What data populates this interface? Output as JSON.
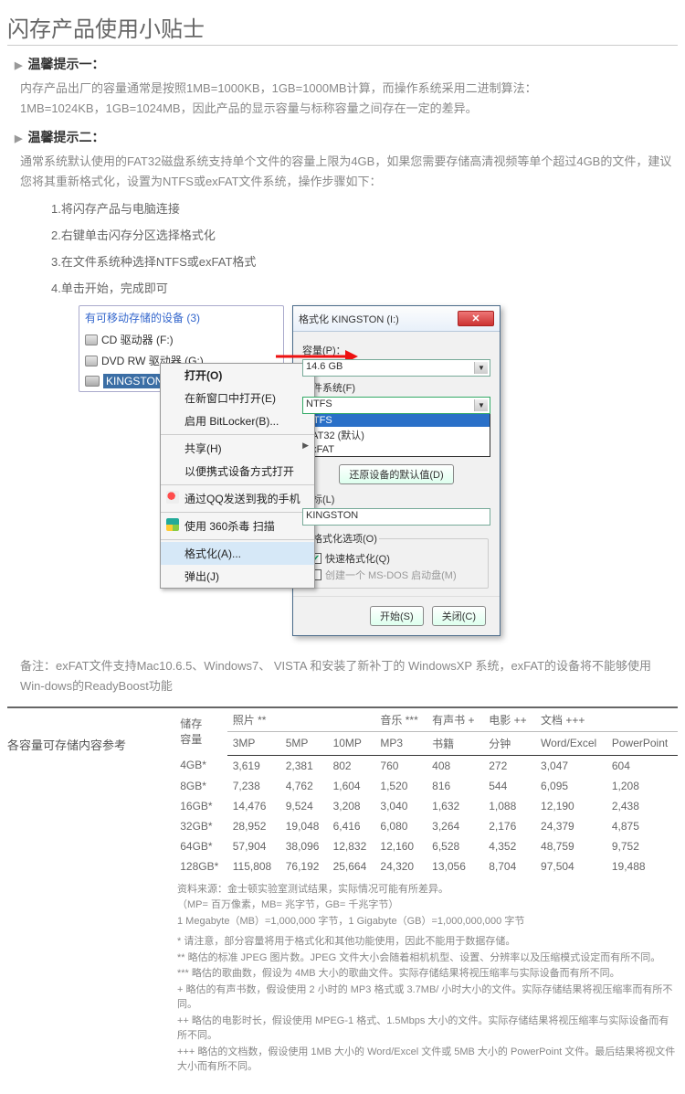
{
  "page": {
    "title": "闪存产品使用小贴士"
  },
  "tips": {
    "title1": "温馨提示一：",
    "text1a": "内存产品出厂的容量通常是按照1MB=1000KB，1GB=1000MB计算，而操作系统采用二进制算法：",
    "text1b": "1MB=1024KB，1GB=1024MB，因此产品的显示容量与标称容量之间存在一定的差异。",
    "title2": "温馨提示二：",
    "text2": "通常系统默认使用的FAT32磁盘系统支持单个文件的容量上限为4GB，如果您需要存储高清视频等单个超过4GB的文件，建议您将其重新格式化，设置为NTFS或exFAT文件系统，操作步骤如下：",
    "steps": [
      "1.将闪存产品与电脑连接",
      "2.右键单击闪存分区选择格式化",
      "3.在文件系统种选择NTFS或exFAT格式",
      "4.单击开始，完成即可"
    ]
  },
  "explorer": {
    "header": "有可移动存储的设备 (3)",
    "drives": [
      "CD 驱动器 (F:)",
      "DVD RW 驱动器 (G:)",
      "KINGSTON (I:)"
    ]
  },
  "context_menu": {
    "open": "打开(O)",
    "new_window": "在新窗口中打开(E)",
    "bitlocker": "启用 BitLocker(B)...",
    "share": "共享(H)",
    "portable": "以便携式设备方式打开",
    "qq": "通过QQ发送到我的手机",
    "scan": "使用 360杀毒 扫描",
    "format": "格式化(A)...",
    "eject": "弹出(J)"
  },
  "dialog": {
    "title": "格式化 KINGSTON (I:)",
    "capacity_label": "容量(P)：",
    "capacity_value": "14.6 GB",
    "fs_label": "文件系统(F)",
    "fs_value": "NTFS",
    "fs_options": [
      "NTFS",
      "FAT32 (默认)",
      "exFAT"
    ],
    "restore_btn": "还原设备的默认值(D)",
    "volume_label": "卷标(L)",
    "volume_value": "KINGSTON",
    "group_title": "格式化选项(O)",
    "quick": "快速格式化(Q)",
    "msdos": "创建一个 MS-DOS 启动盘(M)",
    "start_btn": "开始(S)",
    "close_btn": "关闭(C)"
  },
  "note_after": "备注：exFAT文件支持Mac10.6.5、Windows7、 VISTA  和安装了新补丁的 WindowsXP 系统，exFAT的设备将不能够使用Win-dows的ReadyBoost功能",
  "capacity_table": {
    "section_label": "各容量可存储内容参考",
    "group_headers": [
      "储存\n容量",
      "照片 **",
      "音乐 ***",
      "有声书 +",
      "电影 ++",
      "文档 +++"
    ],
    "sub_headers": [
      "3MP",
      "5MP",
      "10MP",
      "MP3",
      "书籍",
      "分钟",
      "Word/Excel",
      "PowerPoint"
    ],
    "rows": [
      {
        "cap": "4GB*",
        "v": [
          "3,619",
          "2,381",
          "802",
          "760",
          "408",
          "272",
          "3,047",
          "604"
        ]
      },
      {
        "cap": "8GB*",
        "v": [
          "7,238",
          "4,762",
          "1,604",
          "1,520",
          "816",
          "544",
          "6,095",
          "1,208"
        ]
      },
      {
        "cap": "16GB*",
        "v": [
          "14,476",
          "9,524",
          "3,208",
          "3,040",
          "1,632",
          "1,088",
          "12,190",
          "2,438"
        ]
      },
      {
        "cap": "32GB*",
        "v": [
          "28,952",
          "19,048",
          "6,416",
          "6,080",
          "3,264",
          "2,176",
          "24,379",
          "4,875"
        ]
      },
      {
        "cap": "64GB*",
        "v": [
          "57,904",
          "38,096",
          "12,832",
          "12,160",
          "6,528",
          "4,352",
          "48,759",
          "9,752"
        ]
      },
      {
        "cap": "128GB*",
        "v": [
          "115,808",
          "76,192",
          "25,664",
          "24,320",
          "13,056",
          "8,704",
          "97,504",
          "19,488"
        ]
      }
    ]
  },
  "footnotes": {
    "f1": "资料来源：金士顿实验室测试结果，实际情况可能有所差异。",
    "f2": "（MP= 百万像素，MB= 兆字节，GB= 千兆字节）",
    "f3": "1 Megabyte（MB）=1,000,000 字节，1 Gigabyte（GB）=1,000,000,000 字节",
    "f4": "* 请注意，部分容量将用于格式化和其他功能使用，因此不能用于数据存储。",
    "f5": "** 略估的标准 JPEG 图片数。JPEG 文件大小会随着相机机型、设置、分辨率以及压缩模式设定而有所不同。",
    "f6": "*** 略估的歌曲数，假设为 4MB 大小的歌曲文件。实际存储结果将视压缩率与实际设备而有所不同。",
    "f7": "+ 略估的有声书数，假设使用 2 小时的 MP3 格式或 3.7MB/ 小时大小的文件。实际存储结果将视压缩率而有所不同。",
    "f8": "++ 略估的电影时长，假设使用 MPEG-1 格式、1.5Mbps 大小的文件。实际存储结果将视压缩率与实际设备而有所不同。",
    "f9": "+++ 略估的文档数，假设使用 1MB 大小的 Word/Excel 文件或 5MB 大小的 PowerPoint 文件。最后结果将视文件大小而有所不同。"
  }
}
